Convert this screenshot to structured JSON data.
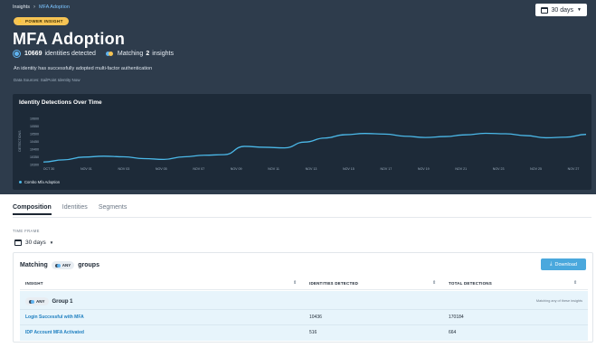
{
  "breadcrumb": {
    "root": "Insights",
    "separator": "›",
    "current": "MFA Adoption"
  },
  "header_timeframe": {
    "label": "30 days"
  },
  "badge": {
    "label": "POWER INSIGHT"
  },
  "title": "MFA Adoption",
  "stats": {
    "identities_count": "10669",
    "identities_text": "identities detected",
    "matching_prefix": "Matching",
    "matching_count": "2",
    "matching_suffix": "insights"
  },
  "description": "An identity has successfully adopted multi-factor authentication",
  "data_sources": "Data Sources: SailPoint Identity Now",
  "chart_data": {
    "type": "line",
    "title": "Identity Detections Over Time",
    "ylabel": "DETECTIONS",
    "y_ticks": [
      "10600",
      "10550",
      "10500",
      "10450",
      "10400",
      "10350",
      "10300"
    ],
    "ylim": [
      10290,
      10620
    ],
    "x_ticks": [
      "OCT 30",
      "NOV 01",
      "NOV 03",
      "NOV 05",
      "NOV 07",
      "NOV 09",
      "NOV 11",
      "NOV 13",
      "NOV 15",
      "NOV 17",
      "NOV 19",
      "NOV 21",
      "NOV 23",
      "NOV 25",
      "NOV 27"
    ],
    "series": [
      {
        "name": "Combo Mfa Adoption",
        "values": [
          10318,
          10332,
          10350,
          10356,
          10352,
          10340,
          10335,
          10352,
          10362,
          10366,
          10420,
          10414,
          10410,
          10448,
          10474,
          10496,
          10504,
          10500,
          10486,
          10478,
          10484,
          10495,
          10505,
          10502,
          10490,
          10476,
          10480,
          10498
        ]
      }
    ],
    "grid": false,
    "legend_position": "bottom-left"
  },
  "tabs": [
    {
      "label": "Composition",
      "active": true
    },
    {
      "label": "Identities",
      "active": false
    },
    {
      "label": "Segments",
      "active": false
    }
  ],
  "timeframe": {
    "label": "TIME FRAME",
    "value": "30 days"
  },
  "matching": {
    "prefix": "Matching",
    "chip": "ANY",
    "suffix": "groups",
    "download_label": "Download"
  },
  "table": {
    "headers": [
      "INSIGHT",
      "IDENTITIES DETECTED",
      "TOTAL DETECTIONS"
    ],
    "group": {
      "chip": "ANY",
      "name": "Group 1",
      "note": "Matching any of these insights"
    },
    "rows": [
      {
        "insight": "Login Successful with MFA",
        "identities": "10436",
        "detections": "170184"
      },
      {
        "insight": "IDP Account MFA Activated",
        "identities": "516",
        "detections": "664"
      }
    ]
  },
  "colors": {
    "header_bg": "#2e3c4c",
    "chart_bg": "#1d2a38",
    "line": "#4bb8e8",
    "badge": "#f6c454",
    "accent": "#4aa8dd",
    "link": "#1e7fc0"
  }
}
